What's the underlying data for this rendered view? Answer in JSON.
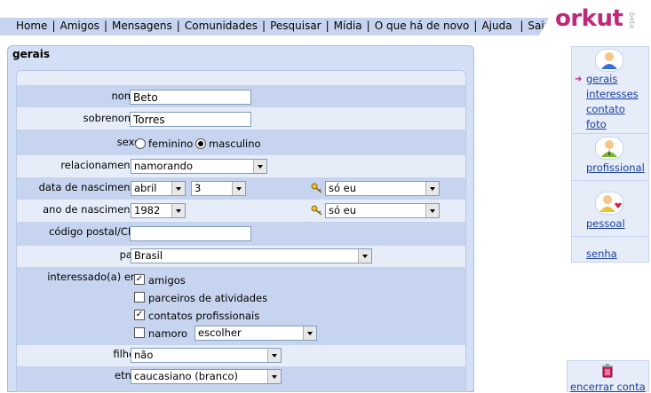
{
  "nav": {
    "links": [
      "Home",
      "Amigos",
      "Mensagens",
      "Comunidades",
      "Pesquisar",
      "Mídia",
      "O que há de novo",
      "Ajuda",
      "Sair"
    ],
    "logo": "orkut",
    "beta": "beta"
  },
  "panel": {
    "title": "gerais"
  },
  "form": {
    "nome": {
      "label": "nome:",
      "value": "Beto"
    },
    "sobrenome": {
      "label": "sobrenome:",
      "value": "Torres"
    },
    "sexo": {
      "label": "sexo:",
      "options": [
        "feminino",
        "masculino"
      ],
      "selected": "masculino"
    },
    "relacionamento": {
      "label": "relacionamento:",
      "value": "namorando"
    },
    "data_nascimento": {
      "label": "data de nascimento:",
      "month": "abril",
      "day": "3",
      "privacy": "só eu"
    },
    "ano_nascimento": {
      "label": "ano de nascimento:",
      "year": "1982",
      "privacy": "só eu"
    },
    "cep": {
      "label": "código postal/CEP:",
      "value": ""
    },
    "pais": {
      "label": "país:",
      "value": "Brasil"
    },
    "interessado": {
      "label": "interessado(a) em:",
      "items": [
        {
          "label": "amigos",
          "checked": true
        },
        {
          "label": "parceiros de atividades",
          "checked": false
        },
        {
          "label": "contatos profissionais",
          "checked": true
        },
        {
          "label": "namoro",
          "checked": false
        }
      ],
      "namoro_select": "escolher"
    },
    "filhos": {
      "label": "filhos:",
      "value": "não"
    },
    "etnia": {
      "label": "etnia:",
      "value": "caucasiano (branco)"
    }
  },
  "sidebar": {
    "gerais": "gerais",
    "interesses": "interesses",
    "contato": "contato",
    "foto": "foto",
    "profissional": "profissional",
    "pessoal": "pessoal",
    "senha": "senha"
  },
  "logout": {
    "label": "encerrar conta"
  },
  "colors": {
    "accent": "#c0287a",
    "link": "#1a3f9e",
    "bar": "#c6d4ef"
  }
}
